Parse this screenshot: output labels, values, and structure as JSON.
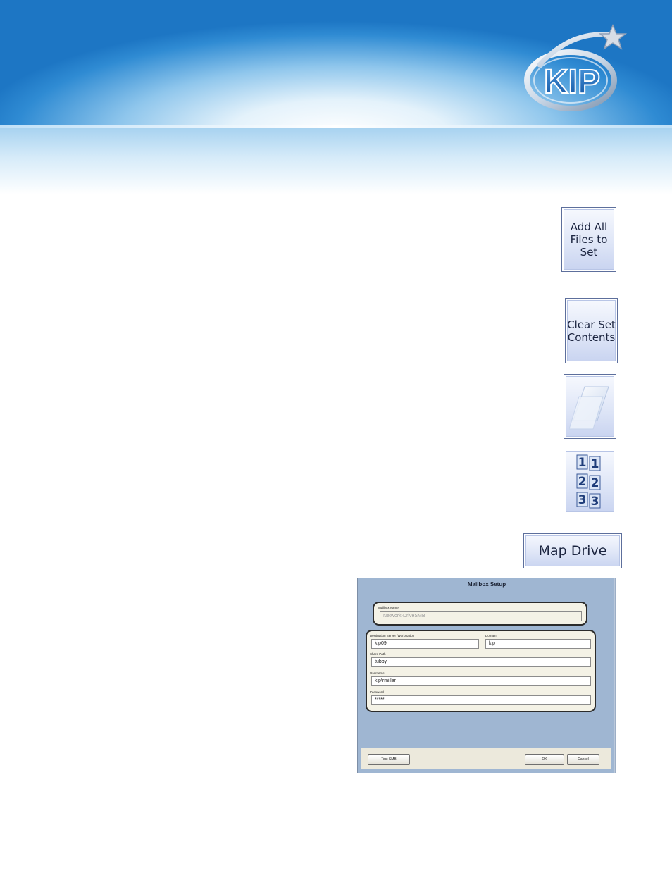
{
  "header": {
    "logo_text": "KIP",
    "colors": {
      "sky_dark": "#1d76c4",
      "sky_light": "#e4f2fb"
    }
  },
  "buttons": {
    "add_all": {
      "label": "Add All\nFiles to\nSet",
      "icon": "add-all-files-icon"
    },
    "clear_set": {
      "label": "Clear Set\nContents",
      "icon": "clear-set-icon"
    },
    "single_page_icon": "page-stack-icon",
    "collate_icon": "collate-numbers-icon",
    "collate_numbers": [
      "1",
      "1",
      "2",
      "2",
      "3",
      "3"
    ],
    "map_drive": {
      "label": "Map Drive"
    }
  },
  "mailbox_setup": {
    "title": "Mailbox Setup",
    "mailbox_name": {
      "label": "Mailbox Name",
      "value": "Network-DriveSMB"
    },
    "destination_server": {
      "label": "Destination Server /Workstation",
      "value": "kip09"
    },
    "domain": {
      "label": "Domain",
      "value": "kip"
    },
    "share_path": {
      "label": "Share Path",
      "value": "tubby"
    },
    "username": {
      "label": "Username",
      "value": "kip\\rmiller"
    },
    "password": {
      "label": "Password",
      "value": "*****"
    },
    "test_smb_label": "Test SMB",
    "ok_label": "OK",
    "cancel_label": "Cancel"
  }
}
